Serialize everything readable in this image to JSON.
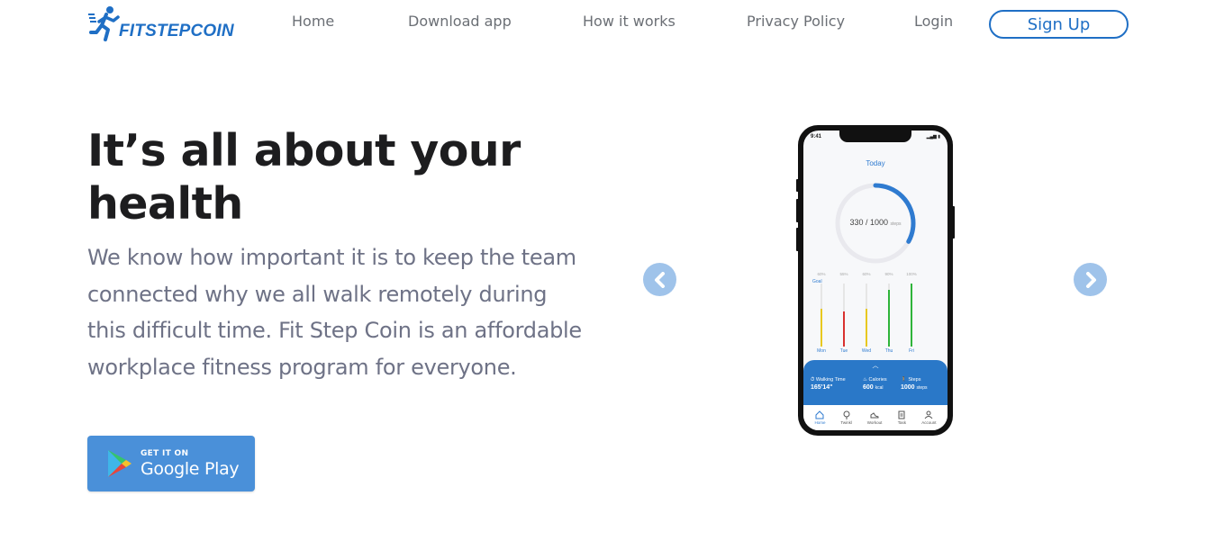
{
  "brand": {
    "name": "FITSTEPCOIN",
    "logo_icon": "running-man-icon",
    "color": "#1f6fc5"
  },
  "nav": {
    "items": [
      {
        "label": "Home"
      },
      {
        "label": "Download app"
      },
      {
        "label": "How it works"
      },
      {
        "label": "Privacy Policy"
      },
      {
        "label": "Login"
      }
    ],
    "signup_label": "Sign Up"
  },
  "hero": {
    "title": "It’s all about your health",
    "description": "We know how important it is to keep the team connected why we all walk remotely during this difficult time. Fit Step Coin is an affordable workplace fitness program for everyone.",
    "store_badge": {
      "small": "GET IT ON",
      "big": "Google Play",
      "icon": "google-play-icon",
      "color": "#4a90d9"
    }
  },
  "carousel": {
    "prev_icon": "chevron-left-icon",
    "next_icon": "chevron-right-icon",
    "arrow_color": "#9fc3ea"
  },
  "phone": {
    "status_time": "9:41",
    "today_label": "Today",
    "steps_current": 330,
    "steps_goal": 1000,
    "steps_label": "330 / 1000",
    "steps_unit": "steps",
    "goal_label": "Goal",
    "days": [
      {
        "day": "Mon",
        "pct_label": "60%",
        "level": 0.6,
        "color": "#e8c81f"
      },
      {
        "day": "Tue",
        "pct_label": "55%",
        "level": 0.55,
        "color": "#d9312f"
      },
      {
        "day": "Wed",
        "pct_label": "60%",
        "level": 0.6,
        "color": "#e8c81f"
      },
      {
        "day": "Thu",
        "pct_label": "90%",
        "level": 0.9,
        "color": "#2fb43a"
      },
      {
        "day": "Fri",
        "pct_label": "100%",
        "level": 1.0,
        "color": "#2fb43a"
      }
    ],
    "stats": {
      "walking_time": {
        "label": "Walking Time",
        "value": "165'14\""
      },
      "calories": {
        "label": "Calories",
        "value": "600",
        "unit": "kcal"
      },
      "steps": {
        "label": "Steps",
        "value": "1000",
        "unit": "steps"
      }
    },
    "tabs": [
      {
        "label": "Home",
        "icon": "home-icon",
        "active": true
      },
      {
        "label": "Twinkl",
        "icon": "map-pin-icon",
        "active": false
      },
      {
        "label": "Workout",
        "icon": "sneaker-icon",
        "active": false
      },
      {
        "label": "Task",
        "icon": "clipboard-icon",
        "active": false
      },
      {
        "label": "Account",
        "icon": "user-icon",
        "active": false
      }
    ]
  }
}
